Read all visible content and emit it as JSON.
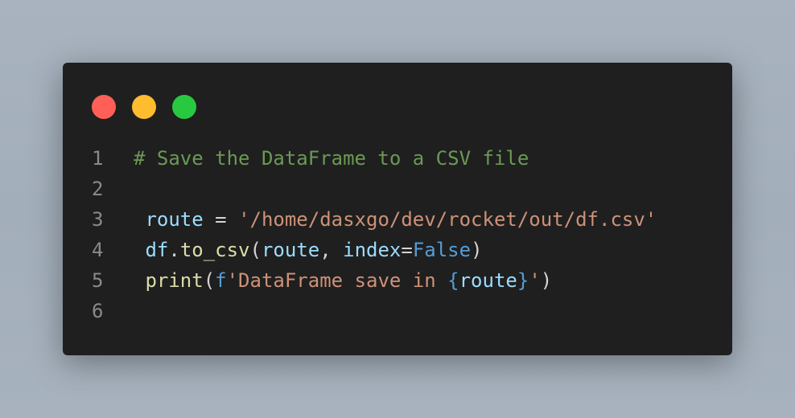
{
  "window_controls": [
    {
      "name": "close",
      "color": "#ff5f57"
    },
    {
      "name": "minimize",
      "color": "#febc2e"
    },
    {
      "name": "maximize",
      "color": "#28c840"
    }
  ],
  "code": {
    "language": "python",
    "lines": [
      {
        "number": "1",
        "tokens": [
          {
            "type": "comment",
            "text": "# Save the DataFrame to a CSV file"
          }
        ]
      },
      {
        "number": "2",
        "tokens": []
      },
      {
        "number": "3",
        "tokens": [
          {
            "type": "var",
            "text": " route"
          },
          {
            "type": "op",
            "text": " = "
          },
          {
            "type": "str",
            "text": "'/home/dasxgo/dev/rocket/out/df.csv'"
          }
        ]
      },
      {
        "number": "4",
        "tokens": [
          {
            "type": "var",
            "text": " df"
          },
          {
            "type": "op",
            "text": "."
          },
          {
            "type": "func",
            "text": "to_csv"
          },
          {
            "type": "punct",
            "text": "("
          },
          {
            "type": "var",
            "text": "route"
          },
          {
            "type": "punct",
            "text": ", "
          },
          {
            "type": "var",
            "text": "index"
          },
          {
            "type": "op",
            "text": "="
          },
          {
            "type": "kw",
            "text": "False"
          },
          {
            "type": "punct",
            "text": ")"
          }
        ]
      },
      {
        "number": "5",
        "tokens": [
          {
            "type": "func",
            "text": " print"
          },
          {
            "type": "punct",
            "text": "("
          },
          {
            "type": "kw",
            "text": "f"
          },
          {
            "type": "str",
            "text": "'DataFrame save in "
          },
          {
            "type": "kw",
            "text": "{"
          },
          {
            "type": "var",
            "text": "route"
          },
          {
            "type": "kw",
            "text": "}"
          },
          {
            "type": "str",
            "text": "'"
          },
          {
            "type": "punct",
            "text": ")"
          }
        ]
      },
      {
        "number": "6",
        "tokens": []
      }
    ]
  }
}
